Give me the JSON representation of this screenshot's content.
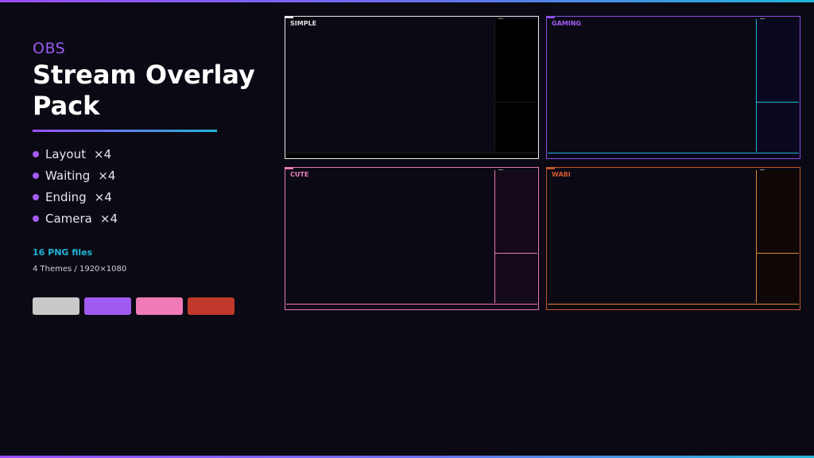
{
  "header": {
    "kicker": "OBS",
    "title_line1": "Stream Overlay",
    "title_line2": "Pack"
  },
  "items": [
    {
      "label": "Layout",
      "count": "×4"
    },
    {
      "label": "Waiting",
      "count": "×4"
    },
    {
      "label": "Ending",
      "count": "×4"
    },
    {
      "label": "Camera",
      "count": "×4"
    }
  ],
  "files": "16 PNG files",
  "spec": "4 Themes / 1920×1080",
  "swatches": [
    {
      "name": "simple",
      "color": "#c8c8c8"
    },
    {
      "name": "gaming",
      "color": "#a05af0"
    },
    {
      "name": "cute",
      "color": "#f07ab8"
    },
    {
      "name": "wabi",
      "color": "#c0392b"
    }
  ],
  "themes": [
    {
      "label": "SIMPLE",
      "border": "#e8e8e8",
      "text": "#e0e0e0",
      "panel": "#000000",
      "divider": "#1a1a1a"
    },
    {
      "label": "GAMING",
      "border": "#8a4fe8",
      "text": "#a35cf5",
      "panel": "#0a0820",
      "divider": "#1fb5d8"
    },
    {
      "label": "CUTE",
      "border": "#e879b6",
      "text": "#ef7fc0",
      "panel": "#150a1a",
      "divider": "#e879b6"
    },
    {
      "label": "WABI",
      "border": "#c0552e",
      "text": "#d05a30",
      "panel": "#0f0806",
      "divider": "#d98a2e"
    }
  ]
}
